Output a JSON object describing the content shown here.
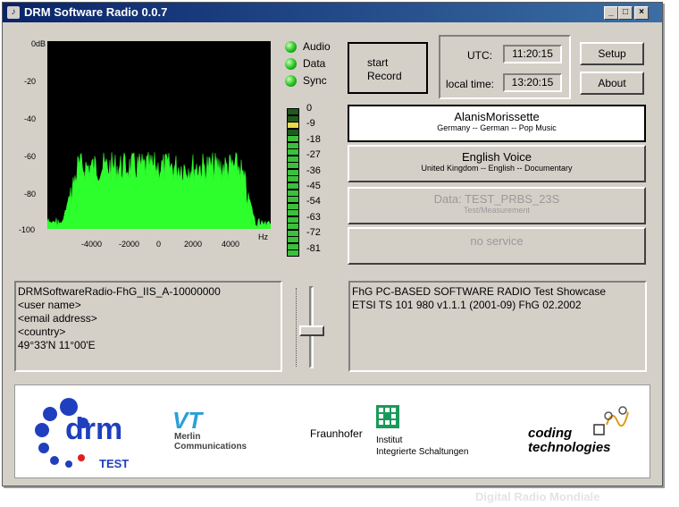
{
  "window": {
    "title": "DRM Software Radio 0.0.7",
    "minimize": "_",
    "maximize": "□",
    "close": "×"
  },
  "spectrum": {
    "y_labels": [
      "0dB",
      "-20",
      "-40",
      "-60",
      "-80",
      "-100"
    ],
    "x_labels": [
      "-4000",
      "-2000",
      "0",
      "2000",
      "4000"
    ],
    "x_unit": "Hz"
  },
  "indicators": [
    {
      "label": "Audio",
      "color": "#22c020"
    },
    {
      "label": "Data",
      "color": "#22c020"
    },
    {
      "label": "Sync",
      "color": "#22c020"
    }
  ],
  "level_meter": {
    "labels": [
      "0",
      "-9",
      "-18",
      "-27",
      "-36",
      "-45",
      "-54",
      "-63",
      "-72",
      "-81"
    ],
    "level": 0.8
  },
  "controls": {
    "record_line1": "start",
    "record_line2": "Record",
    "setup": "Setup",
    "about": "About"
  },
  "clock": {
    "utc_label": "UTC:",
    "utc_value": "11:20:15",
    "local_label": "local time:",
    "local_value": "13:20:15"
  },
  "services": [
    {
      "name": "AlanisMorissette",
      "detail": "Germany -- German -- Pop Music",
      "state": "selected"
    },
    {
      "name": "English Voice",
      "detail": "United Kingdom -- English -- Documentary",
      "state": "normal"
    },
    {
      "name": "Data: TEST_PRBS_23S",
      "detail": "Test/Measurement",
      "state": "disabled"
    },
    {
      "name": "no service",
      "detail": "",
      "state": "disabled"
    }
  ],
  "station_info": {
    "lines": [
      "DRMSoftwareRadio-FhG_IIS_A-10000000",
      "<user name>",
      "<email address>",
      "<country>",
      "49°33'N   11°00'E"
    ]
  },
  "text_message": {
    "lines": [
      "FhG PC-BASED  SOFTWARE RADIO    Test Showcase",
      "ETSI TS 101 980  v1.1.1 (2001-09)   FhG 02.2002"
    ]
  },
  "volume": {
    "level": 0.45
  },
  "logos": {
    "drm": "drm",
    "drm_sub": "TEST",
    "vt": "VT",
    "vt_line1": "Merlin",
    "vt_line2": "Communications",
    "fraunhofer": "Fraunhofer",
    "fraunhofer_line1": "Institut",
    "fraunhofer_line2": "Integrierte Schaltungen",
    "coding_line1": "coding",
    "coding_line2": "technologies"
  },
  "watermark": "Digital Radio Mondiale"
}
